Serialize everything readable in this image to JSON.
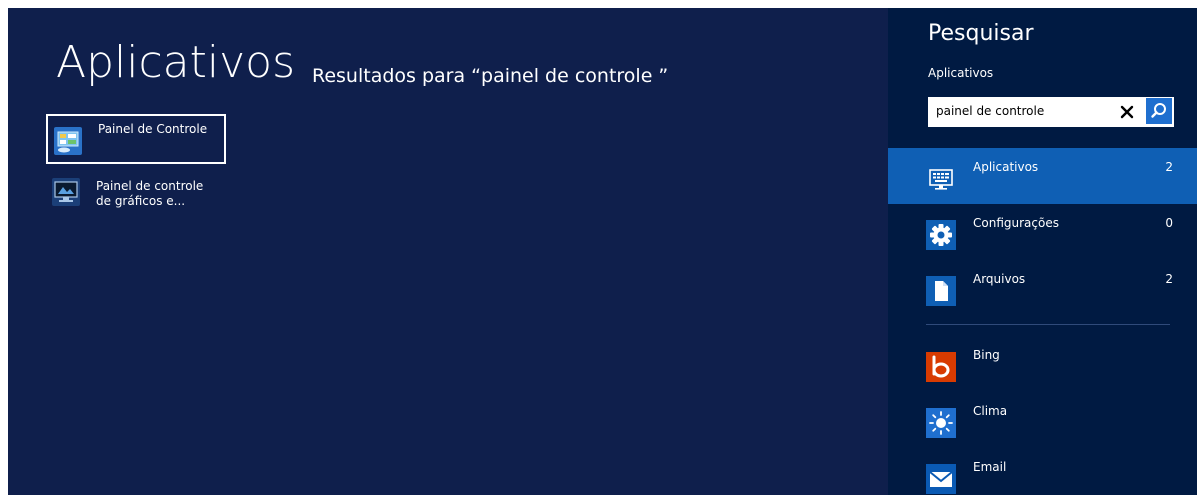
{
  "main": {
    "title": "Aplicativos",
    "subtitle": "Resultados para “painel de controle ”",
    "results": [
      {
        "label_line1": "Painel de Controle",
        "label_line2": "",
        "icon": "control-panel-icon",
        "selected": true
      },
      {
        "label_line1": "Painel de controle",
        "label_line2": "de gráficos e...",
        "icon": "graphics-control-panel-icon",
        "selected": false
      }
    ]
  },
  "search_pane": {
    "title": "Pesquisar",
    "current_scope": "Aplicativos",
    "query": "painel de controle",
    "clear_icon": "close-icon",
    "search_icon": "search-icon",
    "scopes": [
      {
        "label": "Aplicativos",
        "count": "2",
        "icon": "keyboard-monitor-icon",
        "selected": true
      },
      {
        "label": "Configurações",
        "count": "0",
        "icon": "gear-icon",
        "selected": false
      },
      {
        "label": "Arquivos",
        "count": "2",
        "icon": "document-icon",
        "selected": false
      }
    ],
    "apps": [
      {
        "label": "Bing",
        "icon": "bing-icon"
      },
      {
        "label": "Clima",
        "icon": "sun-icon"
      },
      {
        "label": "Email",
        "icon": "mail-icon"
      }
    ]
  },
  "colors": {
    "background": "#0f1f4c",
    "pane_background": "#001a42",
    "accent": "#0f5fb4",
    "search_button": "#1f6fcf",
    "bing_tile": "#d83b01",
    "weather_tile": "#1f6fcf",
    "mail_tile": "#0a5ab4"
  }
}
